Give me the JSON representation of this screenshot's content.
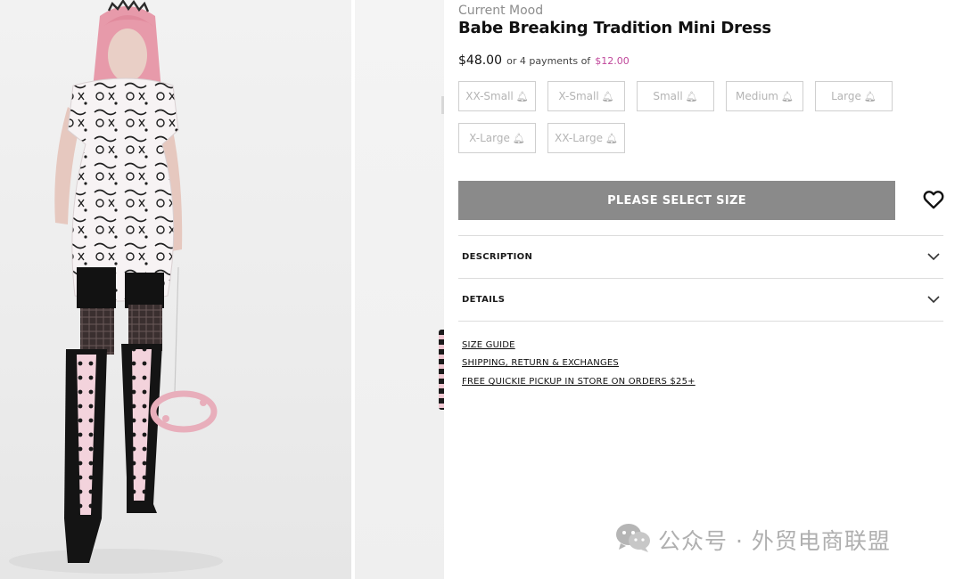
{
  "gallery": {
    "main_image_alt": "model wearing printed mini dress",
    "second_image_alt": "second product image"
  },
  "product": {
    "brand": "Current Mood",
    "title": "Babe Breaking Tradition Mini Dress",
    "price": "$48.00",
    "installment_text": "or 4 payments of",
    "installment_amount": "$12.00"
  },
  "sizes": [
    {
      "label": "XX-Small",
      "icon": "bell-icon"
    },
    {
      "label": "X-Small",
      "icon": "bell-icon"
    },
    {
      "label": "Small",
      "icon": "bell-icon"
    },
    {
      "label": "Medium",
      "icon": "bell-icon"
    },
    {
      "label": "Large",
      "icon": "bell-icon"
    },
    {
      "label": "X-Large",
      "icon": "bell-icon"
    },
    {
      "label": "XX-Large",
      "icon": "bell-icon"
    }
  ],
  "cta": {
    "select_size_label": "PLEASE SELECT SIZE",
    "wishlist_icon": "heart-icon"
  },
  "accordions": [
    {
      "label": "DESCRIPTION",
      "icon": "chevron-down-icon"
    },
    {
      "label": "DETAILS",
      "icon": "chevron-down-icon"
    }
  ],
  "links": [
    "SIZE GUIDE",
    "SHIPPING, RETURN & EXCHANGES",
    "FREE QUICKIE PICKUP IN STORE ON ORDERS $25+"
  ],
  "watermark": {
    "text": "公众号 · 外贸电商联盟",
    "icon": "wechat-icon"
  },
  "colors": {
    "accent_installment": "#c0479b",
    "cta_background": "#8a8a8a",
    "disabled_size_text": "#b4b4b4"
  }
}
